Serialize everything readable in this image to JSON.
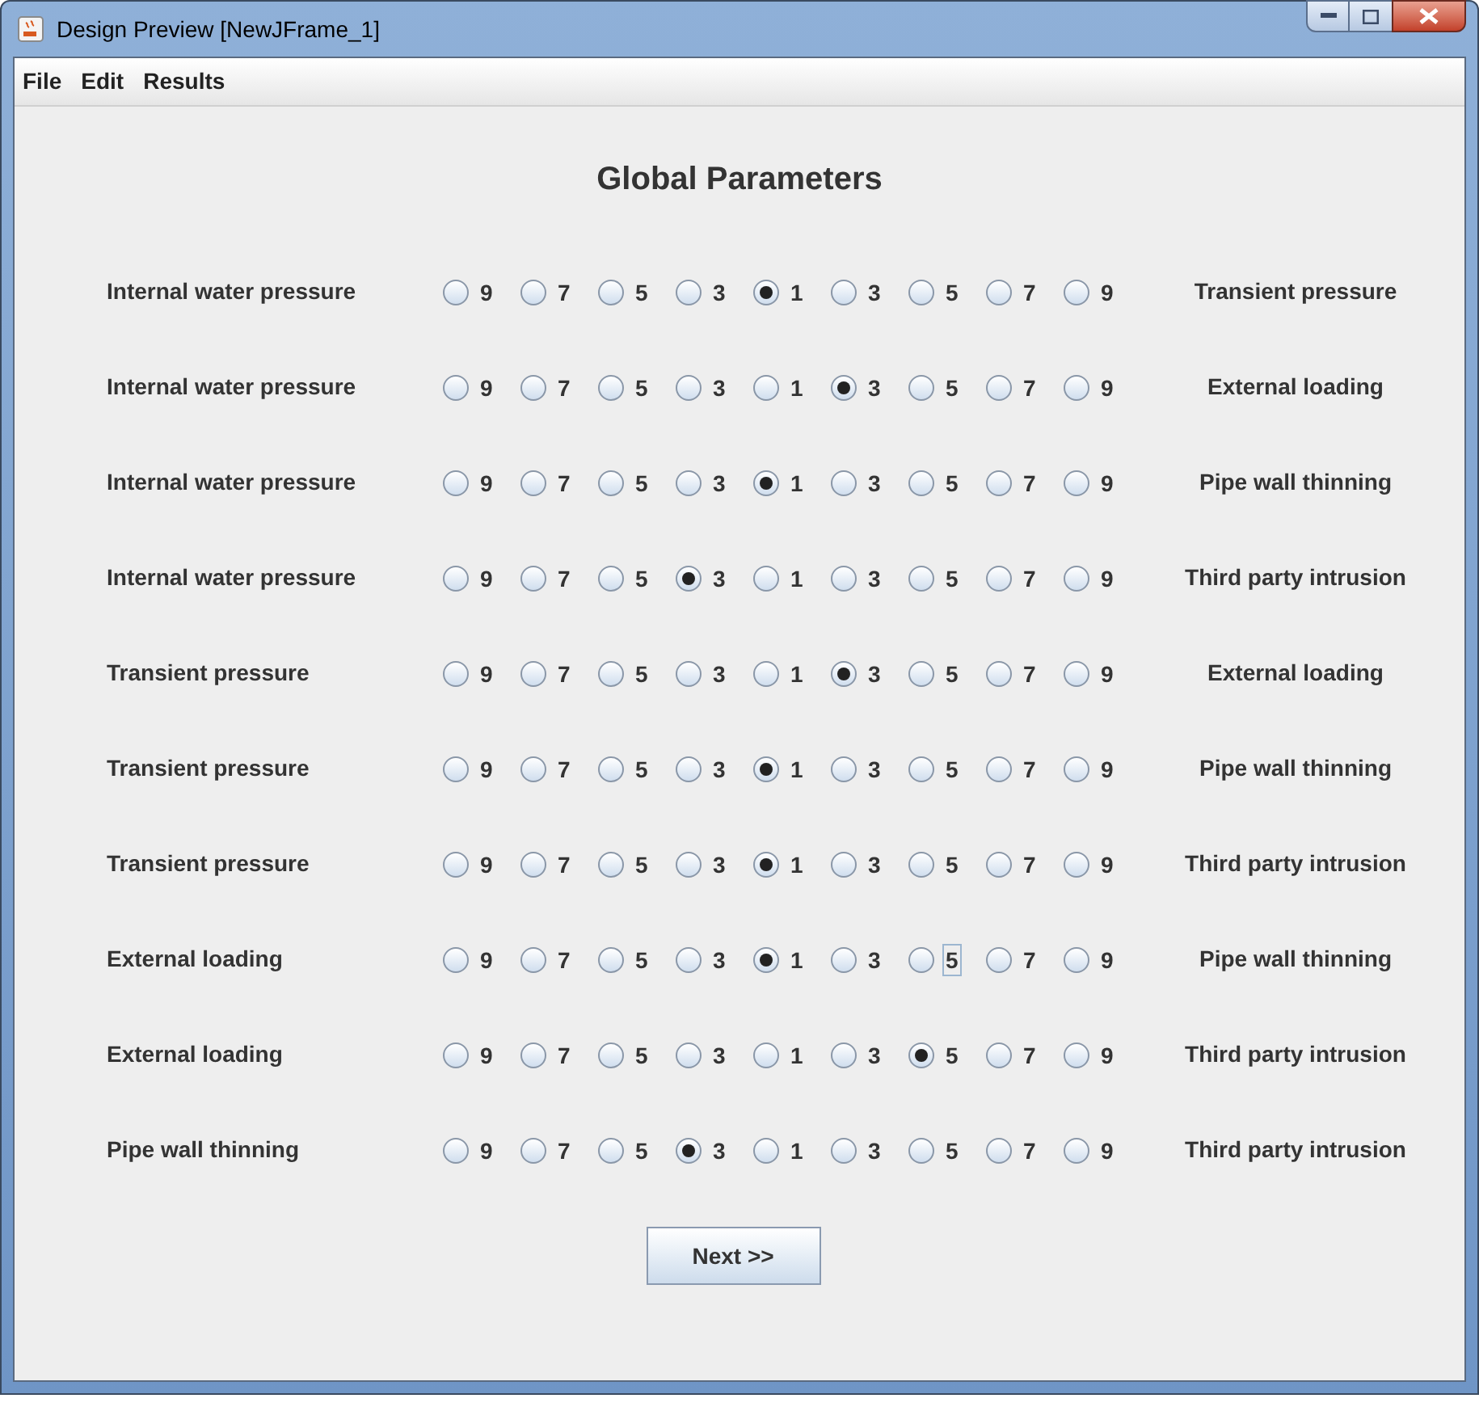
{
  "window": {
    "title": "Design Preview [NewJFrame_1]"
  },
  "menu": [
    "File",
    "Edit",
    "Results"
  ],
  "heading": "Global Parameters",
  "rows": [
    {
      "left": "Internal water pressure",
      "right": "Transient pressure",
      "options": [
        {
          "label": "9",
          "selected": false,
          "focused": false
        },
        {
          "label": "7",
          "selected": false,
          "focused": false
        },
        {
          "label": "5",
          "selected": false,
          "focused": false
        },
        {
          "label": "3",
          "selected": false,
          "focused": false
        },
        {
          "label": "1",
          "selected": true,
          "focused": false
        },
        {
          "label": "3",
          "selected": false,
          "focused": false
        },
        {
          "label": "5",
          "selected": false,
          "focused": false
        },
        {
          "label": "7",
          "selected": false,
          "focused": false
        },
        {
          "label": "9",
          "selected": false,
          "focused": false
        }
      ]
    },
    {
      "left": "Internal water pressure",
      "right": "External loading",
      "options": [
        {
          "label": "9",
          "selected": false,
          "focused": false
        },
        {
          "label": "7",
          "selected": false,
          "focused": false
        },
        {
          "label": "5",
          "selected": false,
          "focused": false
        },
        {
          "label": "3",
          "selected": false,
          "focused": false
        },
        {
          "label": "1",
          "selected": false,
          "focused": false
        },
        {
          "label": "3",
          "selected": true,
          "focused": false
        },
        {
          "label": "5",
          "selected": false,
          "focused": false
        },
        {
          "label": "7",
          "selected": false,
          "focused": false
        },
        {
          "label": "9",
          "selected": false,
          "focused": false
        }
      ]
    },
    {
      "left": "Internal water pressure",
      "right": "Pipe wall thinning",
      "options": [
        {
          "label": "9",
          "selected": false,
          "focused": false
        },
        {
          "label": "7",
          "selected": false,
          "focused": false
        },
        {
          "label": "5",
          "selected": false,
          "focused": false
        },
        {
          "label": "3",
          "selected": false,
          "focused": false
        },
        {
          "label": "1",
          "selected": true,
          "focused": false
        },
        {
          "label": "3",
          "selected": false,
          "focused": false
        },
        {
          "label": "5",
          "selected": false,
          "focused": false
        },
        {
          "label": "7",
          "selected": false,
          "focused": false
        },
        {
          "label": "9",
          "selected": false,
          "focused": false
        }
      ]
    },
    {
      "left": "Internal water pressure",
      "right": "Third party intrusion",
      "options": [
        {
          "label": "9",
          "selected": false,
          "focused": false
        },
        {
          "label": "7",
          "selected": false,
          "focused": false
        },
        {
          "label": "5",
          "selected": false,
          "focused": false
        },
        {
          "label": "3",
          "selected": true,
          "focused": false
        },
        {
          "label": "1",
          "selected": false,
          "focused": false
        },
        {
          "label": "3",
          "selected": false,
          "focused": false
        },
        {
          "label": "5",
          "selected": false,
          "focused": false
        },
        {
          "label": "7",
          "selected": false,
          "focused": false
        },
        {
          "label": "9",
          "selected": false,
          "focused": false
        }
      ]
    },
    {
      "left": "Transient pressure",
      "right": "External loading",
      "options": [
        {
          "label": "9",
          "selected": false,
          "focused": false
        },
        {
          "label": "7",
          "selected": false,
          "focused": false
        },
        {
          "label": "5",
          "selected": false,
          "focused": false
        },
        {
          "label": "3",
          "selected": false,
          "focused": false
        },
        {
          "label": "1",
          "selected": false,
          "focused": false
        },
        {
          "label": "3",
          "selected": true,
          "focused": false
        },
        {
          "label": "5",
          "selected": false,
          "focused": false
        },
        {
          "label": "7",
          "selected": false,
          "focused": false
        },
        {
          "label": "9",
          "selected": false,
          "focused": false
        }
      ]
    },
    {
      "left": "Transient pressure",
      "right": "Pipe wall thinning",
      "options": [
        {
          "label": "9",
          "selected": false,
          "focused": false
        },
        {
          "label": "7",
          "selected": false,
          "focused": false
        },
        {
          "label": "5",
          "selected": false,
          "focused": false
        },
        {
          "label": "3",
          "selected": false,
          "focused": false
        },
        {
          "label": "1",
          "selected": true,
          "focused": false
        },
        {
          "label": "3",
          "selected": false,
          "focused": false
        },
        {
          "label": "5",
          "selected": false,
          "focused": false
        },
        {
          "label": "7",
          "selected": false,
          "focused": false
        },
        {
          "label": "9",
          "selected": false,
          "focused": false
        }
      ]
    },
    {
      "left": "Transient pressure",
      "right": "Third party intrusion",
      "options": [
        {
          "label": "9",
          "selected": false,
          "focused": false
        },
        {
          "label": "7",
          "selected": false,
          "focused": false
        },
        {
          "label": "5",
          "selected": false,
          "focused": false
        },
        {
          "label": "3",
          "selected": false,
          "focused": false
        },
        {
          "label": "1",
          "selected": true,
          "focused": false
        },
        {
          "label": "3",
          "selected": false,
          "focused": false
        },
        {
          "label": "5",
          "selected": false,
          "focused": false
        },
        {
          "label": "7",
          "selected": false,
          "focused": false
        },
        {
          "label": "9",
          "selected": false,
          "focused": false
        }
      ]
    },
    {
      "left": "External loading",
      "right": "Pipe wall thinning",
      "options": [
        {
          "label": "9",
          "selected": false,
          "focused": false
        },
        {
          "label": "7",
          "selected": false,
          "focused": false
        },
        {
          "label": "5",
          "selected": false,
          "focused": false
        },
        {
          "label": "3",
          "selected": false,
          "focused": false
        },
        {
          "label": "1",
          "selected": true,
          "focused": false
        },
        {
          "label": "3",
          "selected": false,
          "focused": false
        },
        {
          "label": "5",
          "selected": false,
          "focused": true
        },
        {
          "label": "7",
          "selected": false,
          "focused": false
        },
        {
          "label": "9",
          "selected": false,
          "focused": false
        }
      ]
    },
    {
      "left": "External loading",
      "right": "Third party intrusion",
      "options": [
        {
          "label": "9",
          "selected": false,
          "focused": false
        },
        {
          "label": "7",
          "selected": false,
          "focused": false
        },
        {
          "label": "5",
          "selected": false,
          "focused": false
        },
        {
          "label": "3",
          "selected": false,
          "focused": false
        },
        {
          "label": "1",
          "selected": false,
          "focused": false
        },
        {
          "label": "3",
          "selected": false,
          "focused": false
        },
        {
          "label": "5",
          "selected": true,
          "focused": false
        },
        {
          "label": "7",
          "selected": false,
          "focused": false
        },
        {
          "label": "9",
          "selected": false,
          "focused": false
        }
      ]
    },
    {
      "left": "Pipe wall thinning",
      "right": "Third party intrusion",
      "options": [
        {
          "label": "9",
          "selected": false,
          "focused": false
        },
        {
          "label": "7",
          "selected": false,
          "focused": false
        },
        {
          "label": "5",
          "selected": false,
          "focused": false
        },
        {
          "label": "3",
          "selected": true,
          "focused": false
        },
        {
          "label": "1",
          "selected": false,
          "focused": false
        },
        {
          "label": "3",
          "selected": false,
          "focused": false
        },
        {
          "label": "5",
          "selected": false,
          "focused": false
        },
        {
          "label": "7",
          "selected": false,
          "focused": false
        },
        {
          "label": "9",
          "selected": false,
          "focused": false
        }
      ]
    }
  ],
  "button": "Next >>"
}
